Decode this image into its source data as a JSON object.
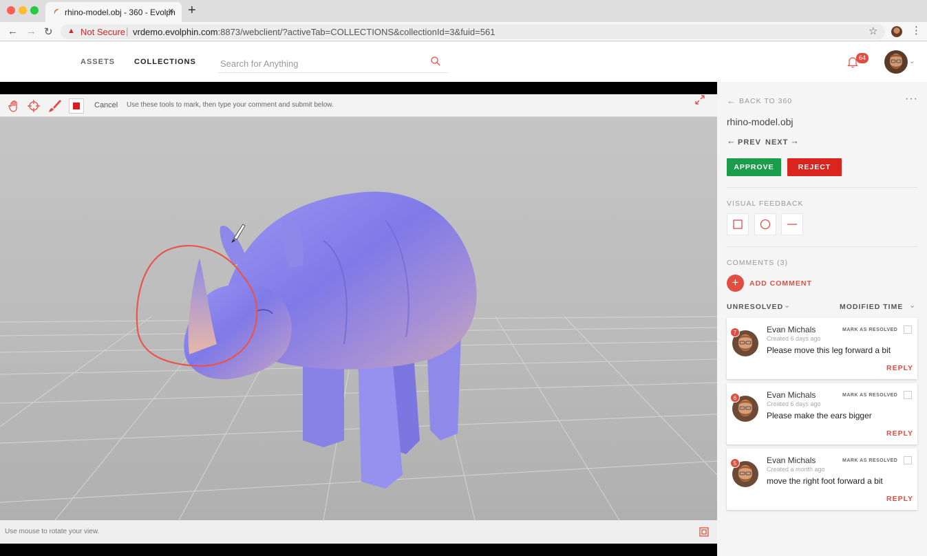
{
  "browser": {
    "tab_title": "rhino-model.obj - 360 - Evolph",
    "security_label": "Not Secure",
    "url_host": "vrdemo.evolphin.com",
    "url_rest": ":8873/webclient/?activeTab=COLLECTIONS&collectionId=3&fuid=561"
  },
  "header": {
    "nav_assets": "ASSETS",
    "nav_collections": "COLLECTIONS",
    "search_placeholder": "Search for Anything",
    "notification_count": "64"
  },
  "viewer": {
    "cancel_label": "Cancel",
    "hint": "Use these tools to mark, then type your comment and submit below.",
    "footer_hint": "Use mouse to rotate your view."
  },
  "panel": {
    "back_label": "BACK TO 360",
    "file_name": "rhino-model.obj",
    "prev_label": "PREV",
    "next_label": "NEXT",
    "approve_label": "APPROVE",
    "reject_label": "REJECT",
    "visual_feedback_label": "VISUAL FEEDBACK",
    "comments_label": "COMMENTS (3)",
    "add_comment_label": "ADD COMMENT",
    "filter_label": "UNRESOLVED",
    "sort_label": "MODIFIED TIME",
    "comments": [
      {
        "number": "7",
        "author": "Evan Michals",
        "time": "Created 6 days ago",
        "text": "Please move this leg forward a bit",
        "resolve_label": "MARK AS RESOLVED",
        "reply_label": "REPLY"
      },
      {
        "number": "6",
        "author": "Evan Michals",
        "time": "Created 6 days ago",
        "text": "Please make the ears bigger",
        "resolve_label": "MARK AS RESOLVED",
        "reply_label": "REPLY"
      },
      {
        "number": "5",
        "author": "Evan Michals",
        "time": "Created a month ago",
        "text": "move the right foot forward a bit",
        "resolve_label": "MARK AS RESOLVED",
        "reply_label": "REPLY"
      }
    ]
  },
  "colors": {
    "accent_red": "#e24d42",
    "approve_green": "#1a9e4b",
    "reject_red": "#d9251d",
    "model_purple": "#8a84ec"
  }
}
